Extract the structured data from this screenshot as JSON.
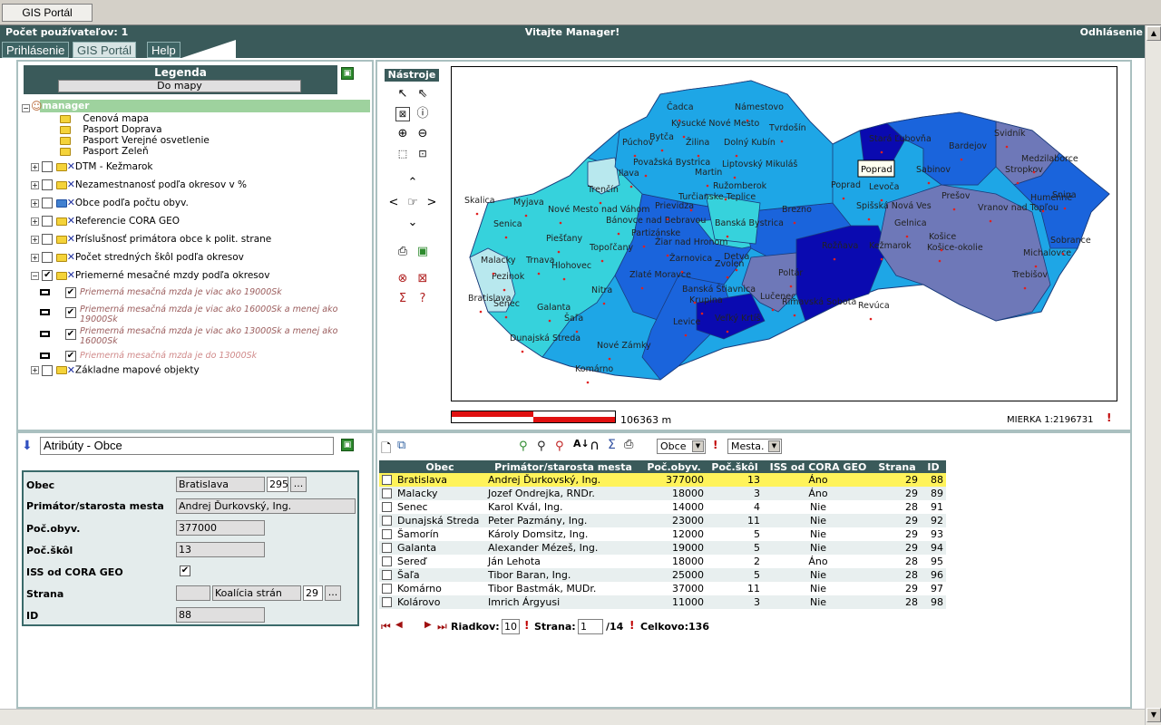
{
  "top_tab": "GIS Portál",
  "header": {
    "users": "Počet používateľov: 1",
    "welcome": "Vitajte Manager!",
    "logout": "Odhlásenie"
  },
  "menu": [
    "Prihlásenie",
    "GIS Portál",
    "Help"
  ],
  "legend": {
    "title": "Legenda",
    "to_map_button": "Do mapy",
    "root": "manager",
    "folders": [
      "Cenová mapa",
      "Pasport Doprava",
      "Pasport Verejné osvetlenie",
      "Pasport Zeleň"
    ],
    "layers": [
      "DTM - Kežmarok",
      "Nezamestnanosť podľa okresov v %",
      "Obce podľa počtu obyv.",
      "Referencie CORA GEO",
      "Príslušnosť primátora obce k polit. strane",
      "Počet stredných škôl podľa okresov",
      "Priemerné mesačné mzdy podľa okresov"
    ],
    "wage_legend": [
      "Priemerná mesačná mzda je viac ako 19000Sk",
      "Priemerná mesačná mzda je viac ako 16000Sk a menej ako 19000Sk",
      "Priemerná mesačná mzda je viac ako 13000Sk a menej ako 16000Sk",
      "Priemerná mesačná mzda je do 13000Sk"
    ],
    "last_layer": "Základne mapové objekty"
  },
  "tools": {
    "title": "Nástroje"
  },
  "map": {
    "tooltip": "Poprad",
    "scale_length": "106363 m",
    "scale_ratio": "MIERKA 1:2196731",
    "colors": {
      "c1": "#0a0ab0",
      "c2": "#1a64dc",
      "c3": "#1ea6e6",
      "c4": "#36d2dc",
      "c5": "#b8e8ee",
      "c6": "#6e78b8"
    },
    "towns": [
      "Čadca",
      "Námestovo",
      "Kysucké Nové Mesto",
      "Tvrdošín",
      "Bytča",
      "Žilina",
      "Dolný Kubín",
      "Púchov",
      "Považská Bystrica",
      "Martin",
      "Ilava",
      "Liptovský Mikuláš",
      "Ružomberok",
      "Trenčín",
      "Turčianske Teplice",
      "Prievidza",
      "Banská Bystrica",
      "Brezno",
      "Poprad",
      "Stará Ľubovňa",
      "Bardejov",
      "Svidník",
      "Medzilaborce",
      "Stropkov",
      "Sabinov",
      "Prešov",
      "Humenné",
      "Snina",
      "Vranov nad Topľou",
      "Levoča",
      "Kežmarok",
      "Spišská Nová Ves",
      "Gelnica",
      "Košice",
      "Košice-okolie",
      "Michalovce",
      "Sobrance",
      "Trebišov",
      "Rožňava",
      "Revúca",
      "Rimavská Sobota",
      "Poltár",
      "Lučenec",
      "Veľký Krtíš",
      "Detva",
      "Zvolen",
      "Krupina",
      "Banská Štiavnica",
      "Žarnovica",
      "Žiar nad Hronom",
      "Zlaté Moravce",
      "Levice",
      "Nitra",
      "Topoľčany",
      "Partizánske",
      "Bánovce nad Bebravou",
      "Nové Mesto nad Váhom",
      "Myjava",
      "Skalica",
      "Senica",
      "Piešťany",
      "Hlohovec",
      "Trnava",
      "Malacky",
      "Pezinok",
      "Bratislava",
      "Senec",
      "Galanta",
      "Šaľa",
      "Dunajská Streda",
      "Nové Zámky",
      "Komárno"
    ]
  },
  "attributes": {
    "title": "Atribúty - Obce",
    "fields": [
      {
        "label": "Obec",
        "value": "Bratislava",
        "extra": "295",
        "button": "..."
      },
      {
        "label": "Primátor/starosta mesta",
        "value": "Andrej Ďurkovský, Ing."
      },
      {
        "label": "Poč.obyv.",
        "value": "377000"
      },
      {
        "label": "Poč.škôl",
        "value": "13"
      },
      {
        "label": "ISS od CORA GEO",
        "value": "✔"
      },
      {
        "label": "Strana",
        "value": "",
        "extra": "Koalícia strán",
        "extra2": "29",
        "button": "..."
      },
      {
        "label": "ID",
        "value": "88"
      }
    ]
  },
  "grid": {
    "layer_select": "Obce",
    "filter_select": "Mesta.",
    "columns": [
      "",
      "Obec",
      "Primátor/starosta mesta",
      "Poč.obyv.",
      "Poč.škôl",
      "ISS od CORA GEO",
      "Strana",
      "ID"
    ],
    "rows": [
      [
        "Bratislava",
        "Andrej Ďurkovský, Ing.",
        "377000",
        "13",
        "Áno",
        "29",
        "88"
      ],
      [
        "Malacky",
        "Jozef Ondrejka, RNDr.",
        "18000",
        "3",
        "Áno",
        "29",
        "89"
      ],
      [
        "Senec",
        "Karol Kvál, Ing.",
        "14000",
        "4",
        "Nie",
        "28",
        "91"
      ],
      [
        "Dunajská Streda",
        "Peter Pazmány, Ing.",
        "23000",
        "11",
        "Nie",
        "29",
        "92"
      ],
      [
        "Šamorín",
        "Károly Domsitz, Ing.",
        "12000",
        "5",
        "Nie",
        "29",
        "93"
      ],
      [
        "Galanta",
        "Alexander Mézeš, Ing.",
        "19000",
        "5",
        "Nie",
        "29",
        "94"
      ],
      [
        "Sereď",
        "Ján Lehota",
        "18000",
        "2",
        "Áno",
        "28",
        "95"
      ],
      [
        "Šaľa",
        "Tibor Baran, Ing.",
        "25000",
        "5",
        "Nie",
        "28",
        "96"
      ],
      [
        "Komárno",
        "Tibor Bastmák, MUDr.",
        "37000",
        "11",
        "Nie",
        "29",
        "97"
      ],
      [
        "Kolárovo",
        "Imrich Árgyusi",
        "11000",
        "3",
        "Nie",
        "28",
        "98"
      ]
    ],
    "pager": {
      "rows_label": "Riadkov:",
      "rows_value": "10",
      "page_label": "Strana:",
      "page_value": "1",
      "page_total": "/14",
      "total_label": "Celkovo:136"
    }
  }
}
